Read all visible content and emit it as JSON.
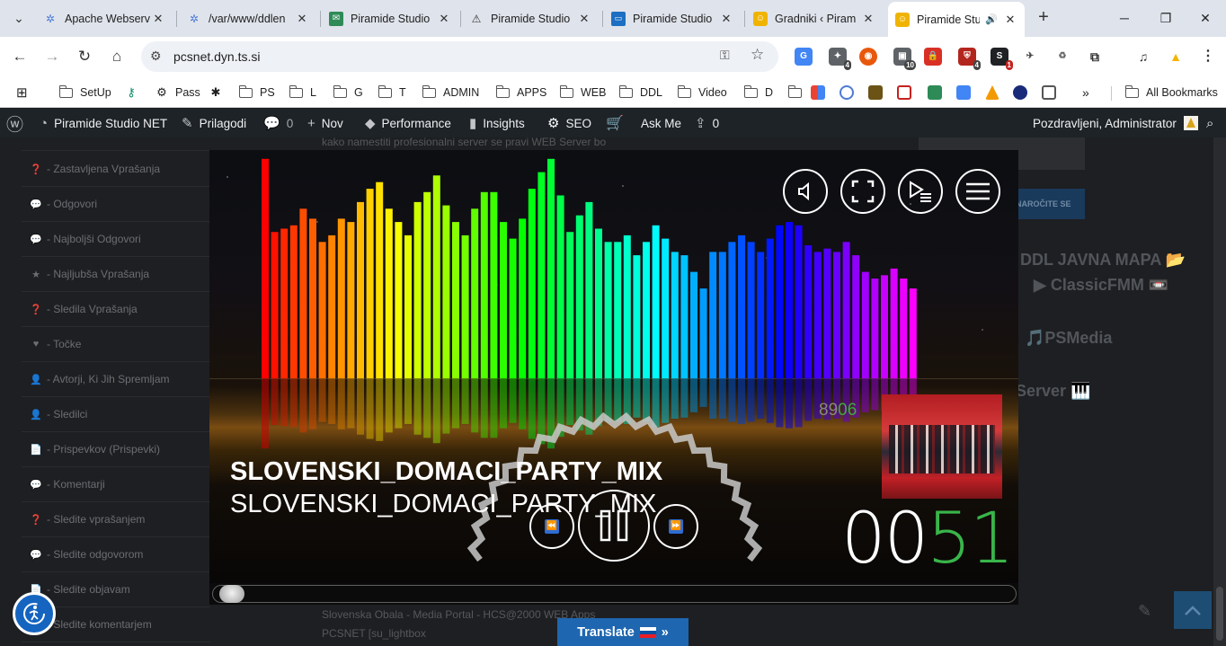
{
  "browser": {
    "tabs": [
      {
        "title": "Apache Webserv",
        "icon": "puzzle-icon",
        "color": "#4c7ad6"
      },
      {
        "title": "/var/www/ddlen",
        "icon": "puzzle-icon",
        "color": "#4c7ad6"
      },
      {
        "title": "Piramide Studio",
        "icon": "mail-icon",
        "color": "#2e8b57"
      },
      {
        "title": "Piramide Studio",
        "icon": "network-icon",
        "color": "#333333"
      },
      {
        "title": "Piramide Studio",
        "icon": "monitor-icon",
        "color": "#1c6fc2"
      },
      {
        "title": "Gradniki ‹ Piram",
        "icon": "smiley-icon",
        "color": "#f0b400"
      },
      {
        "title": "Piramide Stu",
        "icon": "smiley-icon",
        "color": "#f0b400",
        "active": true
      }
    ],
    "url": "pcsnet.dyn.ts.si",
    "extension_badges": [
      "4",
      "10",
      "4",
      "1"
    ],
    "bookmarks": [
      {
        "label": "SetUp",
        "type": "folder"
      },
      {
        "label": "",
        "type": "key"
      },
      {
        "label": "Pass",
        "type": "gear"
      },
      {
        "label": "",
        "type": "puzzle"
      },
      {
        "label": "PS",
        "type": "folder"
      },
      {
        "label": "L",
        "type": "folder"
      },
      {
        "label": "G",
        "type": "folder"
      },
      {
        "label": "T",
        "type": "folder"
      },
      {
        "label": "ADMIN",
        "type": "folder"
      },
      {
        "label": "APPS",
        "type": "folder"
      },
      {
        "label": "WEB",
        "type": "folder"
      },
      {
        "label": "DDL",
        "type": "folder"
      },
      {
        "label": "Video",
        "type": "folder"
      },
      {
        "label": "D",
        "type": "folder"
      }
    ],
    "all_bookmarks": "All Bookmarks",
    "more_bookmarks": "»"
  },
  "adminbar": {
    "site_name": "Piramide Studio NET",
    "customize": "Prilagodi",
    "comments": "0",
    "new": "Nov",
    "performance": "Performance",
    "insights": "Insights",
    "seo": "SEO",
    "ask_me": "Ask Me",
    "updates": "0",
    "greeting": "Pozdravljeni, Administrator"
  },
  "sidebar": {
    "items": [
      {
        "label": "- Zastavljena Vprašanja",
        "icon": "question-icon"
      },
      {
        "label": "- Odgovori",
        "icon": "comments-icon"
      },
      {
        "label": "- Najboljši Odgovori",
        "icon": "comments-icon"
      },
      {
        "label": "- Najljubša Vprašanja",
        "icon": "star-icon"
      },
      {
        "label": "- Sledila Vprašanja",
        "icon": "question-icon"
      },
      {
        "label": "- Točke",
        "icon": "heart-icon"
      },
      {
        "label": "- Avtorji, Ki Jih Spremljam",
        "icon": "user-icon"
      },
      {
        "label": "- Sledilci",
        "icon": "user-icon"
      },
      {
        "label": "- Prispevkov (Prispevki)",
        "icon": "document-icon"
      },
      {
        "label": "- Komentarji",
        "icon": "comments-icon"
      },
      {
        "label": "- Sledite vprašanjem",
        "icon": "question-icon"
      },
      {
        "label": "- Sledite odgovorom",
        "icon": "comments-icon"
      },
      {
        "label": "- Sledite objavam",
        "icon": "document-icon"
      },
      {
        "label": "- Sledite komentarjem",
        "icon": "comments-icon"
      }
    ]
  },
  "content": {
    "top_text": "kako namestiti profesionalni server se pravi WEB Server bo",
    "footer_line1": "Slovenska Obala - Media Portal - HCS@2000 WEB Apps",
    "footer_line2": "PCSNET [su_lightbox",
    "subscribe_button": "NAROČITE SE",
    "right_links": [
      "DDL JAVNA MAPA 📂",
      "▶ ClassicFMM 📼",
      "🎵PSMedia",
      "Server 🎹"
    ]
  },
  "player": {
    "title_bold": "SLOVENSKI_DOMACI_PARTY_MIX",
    "title_regular": "SLOVENSKI_DOMACI_PARTY_MIX",
    "track_count_prefix": "89",
    "track_count_suffix": "06",
    "time_minutes": "00",
    "time_seconds": "51",
    "progress": 0.01,
    "levels": [
      0.66,
      0.44,
      0.45,
      0.46,
      0.51,
      0.48,
      0.41,
      0.43,
      0.48,
      0.47,
      0.53,
      0.57,
      0.59,
      0.51,
      0.47,
      0.43,
      0.53,
      0.56,
      0.61,
      0.52,
      0.47,
      0.43,
      0.51,
      0.56,
      0.56,
      0.47,
      0.42,
      0.48,
      0.57,
      0.62,
      0.66,
      0.55,
      0.44,
      0.49,
      0.53,
      0.45,
      0.41,
      0.41,
      0.43,
      0.37,
      0.41,
      0.46,
      0.42,
      0.38,
      0.37,
      0.32,
      0.27,
      0.38,
      0.38,
      0.41,
      0.43,
      0.41,
      0.38,
      0.42,
      0.46,
      0.47,
      0.46,
      0.4,
      0.38,
      0.39,
      0.38,
      0.41,
      0.37,
      0.32,
      0.3,
      0.31,
      0.33,
      0.3,
      0.27
    ]
  },
  "overlays": {
    "translate_label": "Translate",
    "translate_arrow": "»"
  },
  "colors": {
    "adminbar_bg": "#1d2327",
    "page_bg": "#1e1f22",
    "translate_bg": "#1e66b0",
    "accent_green": "#39b54a"
  }
}
